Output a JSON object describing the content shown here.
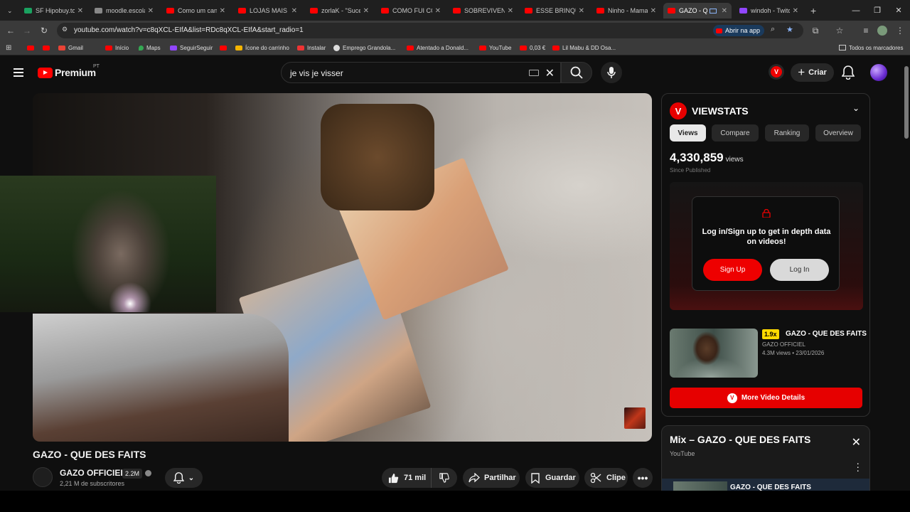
{
  "browser": {
    "tabs": [
      {
        "title": "SF Hipobuy.to",
        "icon": "green-favicon-icon",
        "color": "#1aa260"
      },
      {
        "title": "moodle.escola",
        "icon": "moodle-favicon-icon",
        "color": "#888888"
      },
      {
        "title": "Como um cana",
        "icon": "youtube-favicon-icon",
        "color": "#ff0000"
      },
      {
        "title": "LOJAS MAIS ES",
        "icon": "youtube-favicon-icon",
        "color": "#ff0000"
      },
      {
        "title": "zorlaK - \"Suce",
        "icon": "youtube-favicon-icon",
        "color": "#ff0000"
      },
      {
        "title": "COMO FUI CO",
        "icon": "youtube-favicon-icon",
        "color": "#ff0000"
      },
      {
        "title": "SOBREVIVENDO",
        "icon": "youtube-favicon-icon",
        "color": "#ff0000"
      },
      {
        "title": "ESSE BRINQUE",
        "icon": "youtube-favicon-icon",
        "color": "#ff0000"
      },
      {
        "title": "Ninho - Mama",
        "icon": "youtube-favicon-icon",
        "color": "#ff0000"
      },
      {
        "title": "GAZO - QU",
        "icon": "youtube-favicon-icon",
        "color": "#ff0000",
        "active": true
      },
      {
        "title": "windoh - Twitc",
        "icon": "twitch-favicon-icon",
        "color": "#9146ff"
      }
    ],
    "url": "youtube.com/watch?v=c8qXCL-EIfA&list=RDc8qXCL-EIfA&start_radio=1",
    "open_app_label": "Abrir na app",
    "bookmarks": [
      {
        "label": "",
        "color": "#ff0000"
      },
      {
        "label": "",
        "color": "#ff0000"
      },
      {
        "label": "Gmail",
        "color": "#ea4335"
      },
      {
        "label": "Início",
        "color": "#ff0000"
      },
      {
        "label": "Maps",
        "color": "#34a853"
      },
      {
        "label": "SeguirSeguir",
        "color": "#9146ff"
      },
      {
        "label": "",
        "color": "#ff0000"
      },
      {
        "label": "Ícone do carrinho",
        "color": "#f4b400"
      },
      {
        "label": "Instalar",
        "color": "#ff0000"
      },
      {
        "label": "Emprego Grandola...",
        "color": "#dddddd"
      },
      {
        "label": "Atentado a Donald...",
        "color": "#ff0000"
      },
      {
        "label": "YouTube",
        "color": "#ff0000"
      },
      {
        "label": "0,03 €",
        "color": "#ff0000"
      },
      {
        "label": "Lil Mabu & DD Osa...",
        "color": "#ff0000"
      }
    ],
    "all_bookmarks_label": "Todos os marcadores"
  },
  "youtube": {
    "logo_text": "Premium",
    "country": "PT",
    "search_query": "je vis je visser",
    "create_label": "Criar"
  },
  "video": {
    "title": "GAZO - QUE DES FAITS",
    "channel": "GAZO OFFICIEL",
    "channel_count": "2.2M",
    "subscribers": "2,21 M de subscritores",
    "likes": "71 mil",
    "share_label": "Partilhar",
    "save_label": "Guardar",
    "clip_label": "Clipe"
  },
  "viewstats": {
    "name": "VIEWSTATS",
    "logo_letter": "V",
    "tabs": [
      "Views",
      "Compare",
      "Ranking",
      "Overview"
    ],
    "views": "4,330,859",
    "views_unit": "views",
    "since": "Since Published",
    "login_message": "Log in/Sign up to get in depth data on videos!",
    "signup_label": "Sign Up",
    "login_label": "Log In",
    "related": {
      "multiplier": "1.9x",
      "title": "GAZO - QUE DES FAITS",
      "channel": "GAZO OFFICIEL",
      "meta": "4.3M views • 23/01/2026"
    },
    "more_label": "More Video Details"
  },
  "mix": {
    "title": "Mix – GAZO - QUE DES FAITS",
    "source": "YouTube",
    "first_item": "GAZO - QUE DES FAITS"
  }
}
